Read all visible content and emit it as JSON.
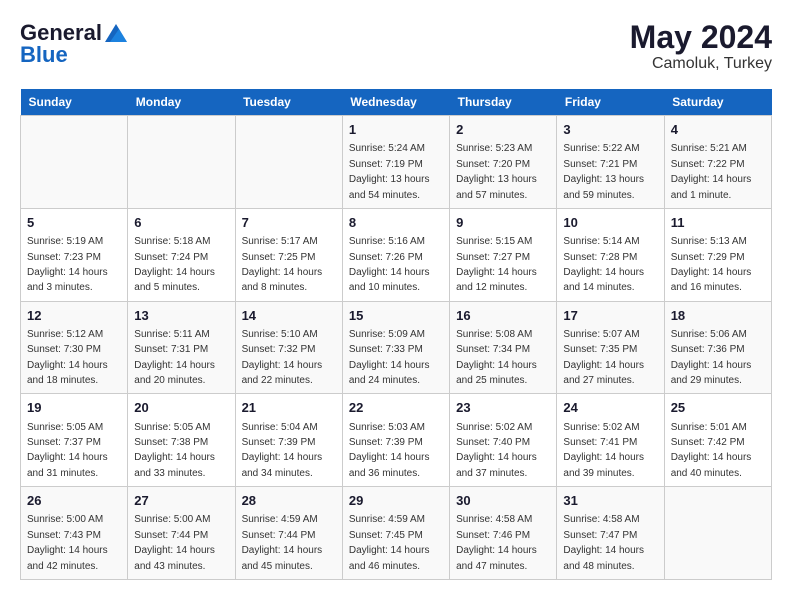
{
  "logo": {
    "general": "General",
    "blue": "Blue"
  },
  "title": {
    "month_year": "May 2024",
    "location": "Camoluk, Turkey"
  },
  "calendar": {
    "headers": [
      "Sunday",
      "Monday",
      "Tuesday",
      "Wednesday",
      "Thursday",
      "Friday",
      "Saturday"
    ],
    "rows": [
      [
        {
          "day": "",
          "sunrise": "",
          "sunset": "",
          "daylight": ""
        },
        {
          "day": "",
          "sunrise": "",
          "sunset": "",
          "daylight": ""
        },
        {
          "day": "",
          "sunrise": "",
          "sunset": "",
          "daylight": ""
        },
        {
          "day": "1",
          "sunrise": "Sunrise: 5:24 AM",
          "sunset": "Sunset: 7:19 PM",
          "daylight": "Daylight: 13 hours and 54 minutes."
        },
        {
          "day": "2",
          "sunrise": "Sunrise: 5:23 AM",
          "sunset": "Sunset: 7:20 PM",
          "daylight": "Daylight: 13 hours and 57 minutes."
        },
        {
          "day": "3",
          "sunrise": "Sunrise: 5:22 AM",
          "sunset": "Sunset: 7:21 PM",
          "daylight": "Daylight: 13 hours and 59 minutes."
        },
        {
          "day": "4",
          "sunrise": "Sunrise: 5:21 AM",
          "sunset": "Sunset: 7:22 PM",
          "daylight": "Daylight: 14 hours and 1 minute."
        }
      ],
      [
        {
          "day": "5",
          "sunrise": "Sunrise: 5:19 AM",
          "sunset": "Sunset: 7:23 PM",
          "daylight": "Daylight: 14 hours and 3 minutes."
        },
        {
          "day": "6",
          "sunrise": "Sunrise: 5:18 AM",
          "sunset": "Sunset: 7:24 PM",
          "daylight": "Daylight: 14 hours and 5 minutes."
        },
        {
          "day": "7",
          "sunrise": "Sunrise: 5:17 AM",
          "sunset": "Sunset: 7:25 PM",
          "daylight": "Daylight: 14 hours and 8 minutes."
        },
        {
          "day": "8",
          "sunrise": "Sunrise: 5:16 AM",
          "sunset": "Sunset: 7:26 PM",
          "daylight": "Daylight: 14 hours and 10 minutes."
        },
        {
          "day": "9",
          "sunrise": "Sunrise: 5:15 AM",
          "sunset": "Sunset: 7:27 PM",
          "daylight": "Daylight: 14 hours and 12 minutes."
        },
        {
          "day": "10",
          "sunrise": "Sunrise: 5:14 AM",
          "sunset": "Sunset: 7:28 PM",
          "daylight": "Daylight: 14 hours and 14 minutes."
        },
        {
          "day": "11",
          "sunrise": "Sunrise: 5:13 AM",
          "sunset": "Sunset: 7:29 PM",
          "daylight": "Daylight: 14 hours and 16 minutes."
        }
      ],
      [
        {
          "day": "12",
          "sunrise": "Sunrise: 5:12 AM",
          "sunset": "Sunset: 7:30 PM",
          "daylight": "Daylight: 14 hours and 18 minutes."
        },
        {
          "day": "13",
          "sunrise": "Sunrise: 5:11 AM",
          "sunset": "Sunset: 7:31 PM",
          "daylight": "Daylight: 14 hours and 20 minutes."
        },
        {
          "day": "14",
          "sunrise": "Sunrise: 5:10 AM",
          "sunset": "Sunset: 7:32 PM",
          "daylight": "Daylight: 14 hours and 22 minutes."
        },
        {
          "day": "15",
          "sunrise": "Sunrise: 5:09 AM",
          "sunset": "Sunset: 7:33 PM",
          "daylight": "Daylight: 14 hours and 24 minutes."
        },
        {
          "day": "16",
          "sunrise": "Sunrise: 5:08 AM",
          "sunset": "Sunset: 7:34 PM",
          "daylight": "Daylight: 14 hours and 25 minutes."
        },
        {
          "day": "17",
          "sunrise": "Sunrise: 5:07 AM",
          "sunset": "Sunset: 7:35 PM",
          "daylight": "Daylight: 14 hours and 27 minutes."
        },
        {
          "day": "18",
          "sunrise": "Sunrise: 5:06 AM",
          "sunset": "Sunset: 7:36 PM",
          "daylight": "Daylight: 14 hours and 29 minutes."
        }
      ],
      [
        {
          "day": "19",
          "sunrise": "Sunrise: 5:05 AM",
          "sunset": "Sunset: 7:37 PM",
          "daylight": "Daylight: 14 hours and 31 minutes."
        },
        {
          "day": "20",
          "sunrise": "Sunrise: 5:05 AM",
          "sunset": "Sunset: 7:38 PM",
          "daylight": "Daylight: 14 hours and 33 minutes."
        },
        {
          "day": "21",
          "sunrise": "Sunrise: 5:04 AM",
          "sunset": "Sunset: 7:39 PM",
          "daylight": "Daylight: 14 hours and 34 minutes."
        },
        {
          "day": "22",
          "sunrise": "Sunrise: 5:03 AM",
          "sunset": "Sunset: 7:39 PM",
          "daylight": "Daylight: 14 hours and 36 minutes."
        },
        {
          "day": "23",
          "sunrise": "Sunrise: 5:02 AM",
          "sunset": "Sunset: 7:40 PM",
          "daylight": "Daylight: 14 hours and 37 minutes."
        },
        {
          "day": "24",
          "sunrise": "Sunrise: 5:02 AM",
          "sunset": "Sunset: 7:41 PM",
          "daylight": "Daylight: 14 hours and 39 minutes."
        },
        {
          "day": "25",
          "sunrise": "Sunrise: 5:01 AM",
          "sunset": "Sunset: 7:42 PM",
          "daylight": "Daylight: 14 hours and 40 minutes."
        }
      ],
      [
        {
          "day": "26",
          "sunrise": "Sunrise: 5:00 AM",
          "sunset": "Sunset: 7:43 PM",
          "daylight": "Daylight: 14 hours and 42 minutes."
        },
        {
          "day": "27",
          "sunrise": "Sunrise: 5:00 AM",
          "sunset": "Sunset: 7:44 PM",
          "daylight": "Daylight: 14 hours and 43 minutes."
        },
        {
          "day": "28",
          "sunrise": "Sunrise: 4:59 AM",
          "sunset": "Sunset: 7:44 PM",
          "daylight": "Daylight: 14 hours and 45 minutes."
        },
        {
          "day": "29",
          "sunrise": "Sunrise: 4:59 AM",
          "sunset": "Sunset: 7:45 PM",
          "daylight": "Daylight: 14 hours and 46 minutes."
        },
        {
          "day": "30",
          "sunrise": "Sunrise: 4:58 AM",
          "sunset": "Sunset: 7:46 PM",
          "daylight": "Daylight: 14 hours and 47 minutes."
        },
        {
          "day": "31",
          "sunrise": "Sunrise: 4:58 AM",
          "sunset": "Sunset: 7:47 PM",
          "daylight": "Daylight: 14 hours and 48 minutes."
        },
        {
          "day": "",
          "sunrise": "",
          "sunset": "",
          "daylight": ""
        }
      ]
    ]
  }
}
